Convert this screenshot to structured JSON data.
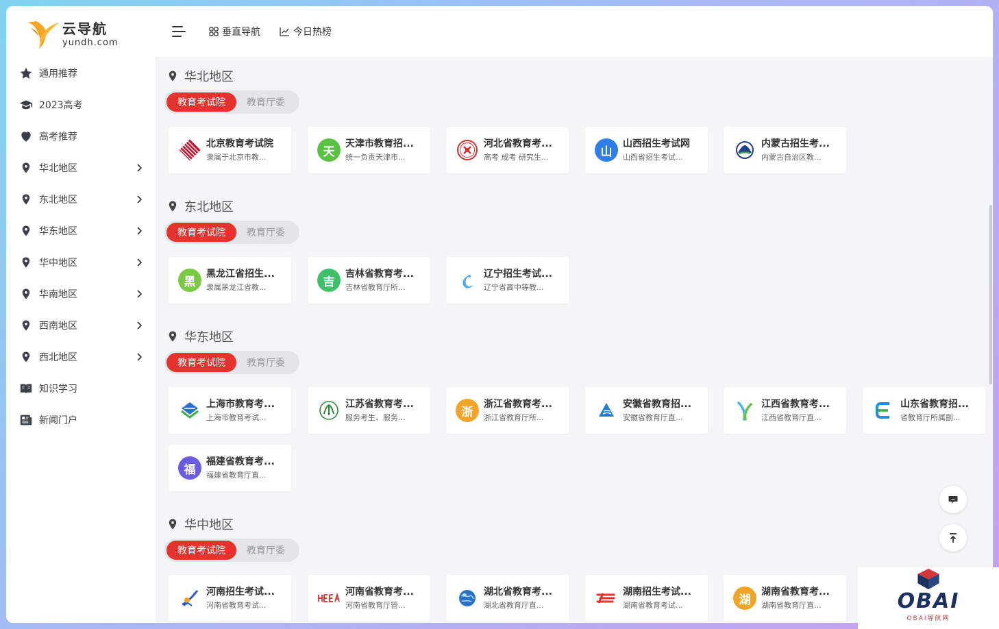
{
  "brand": {
    "name": "云导航",
    "domain": "yundh.com",
    "color": "#f5a623"
  },
  "header": {
    "menu_icon": "menu-fold-icon",
    "links": [
      {
        "label": "垂直导航",
        "icon": "grid-icon"
      },
      {
        "label": "今日热榜",
        "icon": "line-chart-icon"
      }
    ]
  },
  "sidebar": {
    "items": [
      {
        "label": "通用推荐",
        "icon": "star-icon",
        "has_children": false
      },
      {
        "label": "2023高考",
        "icon": "graduation-cap-icon",
        "has_children": false
      },
      {
        "label": "高考推荐",
        "icon": "heart-icon",
        "has_children": false
      },
      {
        "label": "华北地区",
        "icon": "location-pin-icon",
        "has_children": true
      },
      {
        "label": "东北地区",
        "icon": "location-pin-icon",
        "has_children": true
      },
      {
        "label": "华东地区",
        "icon": "location-pin-icon",
        "has_children": true
      },
      {
        "label": "华中地区",
        "icon": "location-pin-icon",
        "has_children": true
      },
      {
        "label": "华南地区",
        "icon": "location-pin-icon",
        "has_children": true
      },
      {
        "label": "西南地区",
        "icon": "location-pin-icon",
        "has_children": true
      },
      {
        "label": "西北地区",
        "icon": "location-pin-icon",
        "has_children": true
      },
      {
        "label": "知识学习",
        "icon": "book-icon",
        "has_children": false
      },
      {
        "label": "新闻门户",
        "icon": "newspaper-icon",
        "has_children": false
      }
    ]
  },
  "tabs": {
    "active": "教育考试院",
    "inactive": "教育厅委",
    "active_color": "#e5322d"
  },
  "regions": [
    {
      "title": "华北地区",
      "cards": [
        {
          "title": "北京教育考试院",
          "desc": "隶属于北京市教...",
          "icon_char": "",
          "icon_color": "#c8102e"
        },
        {
          "title": "天津市教育招...",
          "desc": "统一负责天津市...",
          "icon_char": "天",
          "icon_color": "#5cc245"
        },
        {
          "title": "河北省教育考...",
          "desc": "高考 成考 研究生...",
          "icon_char": "",
          "icon_color": "#d62d2d"
        },
        {
          "title": "山西招生考试网",
          "desc": "山西省招生考试...",
          "icon_char": "山",
          "icon_color": "#2f7ee8"
        },
        {
          "title": "内蒙古招生考...",
          "desc": "内蒙古自治区教...",
          "icon_char": "",
          "icon_color": "#1f3e8c"
        }
      ]
    },
    {
      "title": "东北地区",
      "cards": [
        {
          "title": "黑龙江省招生...",
          "desc": "隶属黑龙江省教...",
          "icon_char": "黑",
          "icon_color": "#7ac943"
        },
        {
          "title": "吉林省教育考...",
          "desc": "吉林省教育厅所...",
          "icon_char": "吉",
          "icon_color": "#3fbf6a"
        },
        {
          "title": "辽宁招生考试...",
          "desc": "辽宁省高中等教...",
          "icon_char": "",
          "icon_color": "#5aa9e6"
        }
      ]
    },
    {
      "title": "华东地区",
      "cards": [
        {
          "title": "上海市教育考...",
          "desc": "上海市教育考试...",
          "icon_char": "",
          "icon_color": "#2a72c9"
        },
        {
          "title": "江苏省教育考...",
          "desc": "服务考生、服务...",
          "icon_char": "",
          "icon_color": "#2e8b3e"
        },
        {
          "title": "浙江省教育考...",
          "desc": "浙江省教育厅所...",
          "icon_char": "浙",
          "icon_color": "#f0a52a"
        },
        {
          "title": "安徽省教育招...",
          "desc": "安徽省教育厅直...",
          "icon_char": "",
          "icon_color": "#1f7bd1"
        },
        {
          "title": "江西省教育考...",
          "desc": "江西省教育厅直...",
          "icon_char": "",
          "icon_color": "#4bb5e8"
        },
        {
          "title": "山东省教育招...",
          "desc": "省教育厅所属副...",
          "icon_char": "",
          "icon_color": "#1e8fd8"
        },
        {
          "title": "福建省教育考...",
          "desc": "福建省教育厅直...",
          "icon_char": "福",
          "icon_color": "#6a5be0"
        }
      ]
    },
    {
      "title": "华中地区",
      "cards": [
        {
          "title": "河南招生考试...",
          "desc": "河南省教育考试...",
          "icon_char": "",
          "icon_color": "#2a5cc2"
        },
        {
          "title": "河南省教育考...",
          "desc": "河南省教育厅管...",
          "icon_char": "",
          "icon_color": "#d62d2d"
        },
        {
          "title": "湖北省教育考...",
          "desc": "湖北省教育厅直...",
          "icon_char": "",
          "icon_color": "#2a72c9"
        },
        {
          "title": "湖南招生考试...",
          "desc": "湖南省教育考试...",
          "icon_char": "",
          "icon_color": "#e5322d"
        },
        {
          "title": "湖南省教育考...",
          "desc": "湖南省教育厅直...",
          "icon_char": "湖",
          "icon_color": "#f0a52a"
        }
      ]
    }
  ],
  "floating": [
    {
      "icon": "chat-icon"
    },
    {
      "icon": "back-to-top-icon"
    }
  ],
  "watermark": {
    "text": "OBAI",
    "sub": "OBAI导航网"
  }
}
